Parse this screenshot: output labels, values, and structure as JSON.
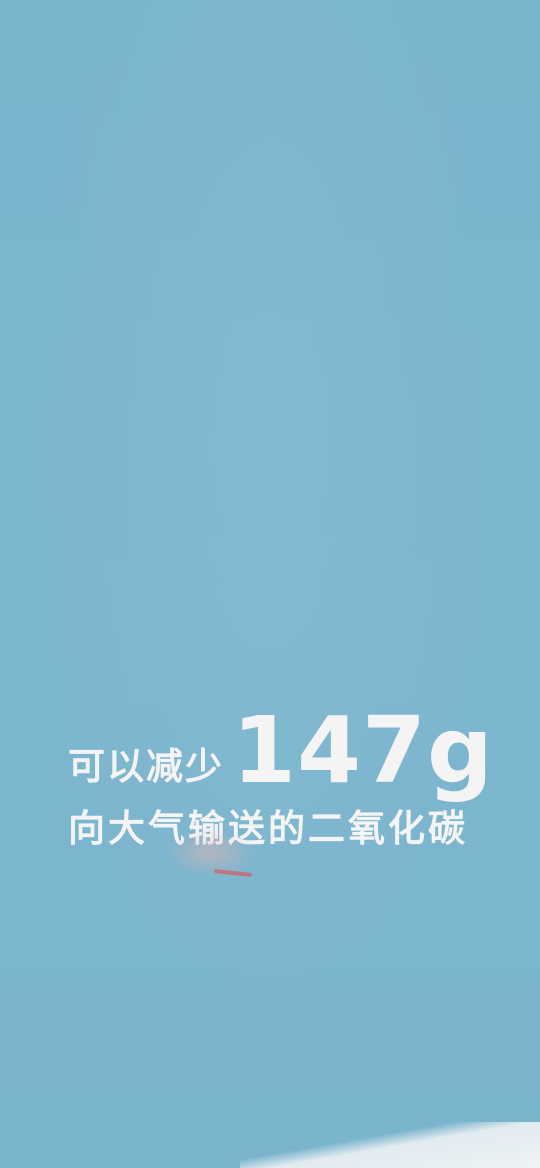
{
  "caption": {
    "prefix": "可以减少",
    "amount": "147g",
    "suffix": "向大气输送的二氧化碳"
  },
  "colors": {
    "background": "#7db6cf",
    "text": "#f4f4f4"
  }
}
